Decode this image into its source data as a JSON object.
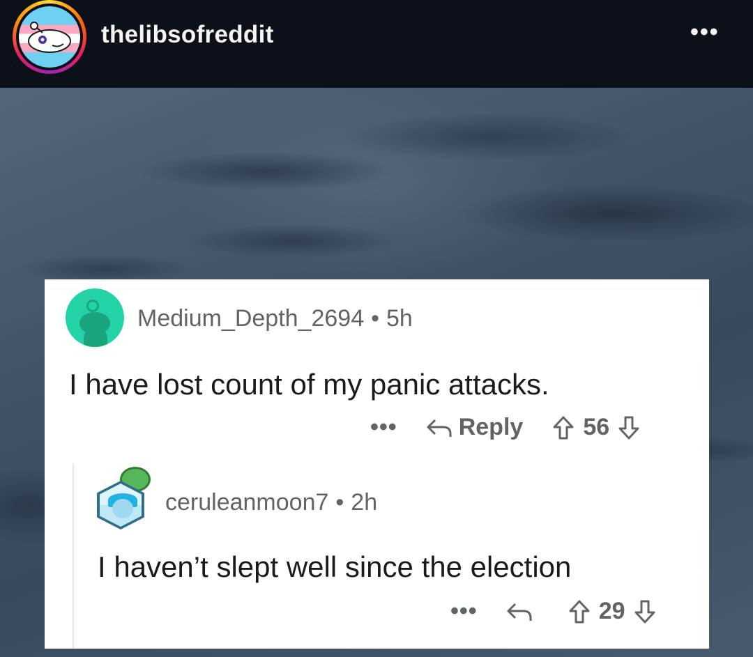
{
  "header": {
    "username": "thelibsofreddit",
    "more_label": "•••"
  },
  "comments": [
    {
      "author": "Medium_Depth_2694",
      "separator": "•",
      "age": "5h",
      "text": "I have lost count of my panic attacks.",
      "more_label": "•••",
      "reply_label": "Reply",
      "votes": "56",
      "avatar_icon": "snoo-avatar-icon",
      "avatar_color": "#24d2a7"
    },
    {
      "author": "ceruleanmoon7",
      "separator": "•",
      "age": "2h",
      "text": "I haven’t slept well since the election",
      "more_label": "•••",
      "votes": "29",
      "avatar_icon": "custom-avatar-icon"
    }
  ],
  "colors": {
    "topbar_bg": "#0c1119",
    "card_bg": "#ffffff",
    "meta_text": "#5f6468",
    "body_text": "#1a1a1b"
  }
}
